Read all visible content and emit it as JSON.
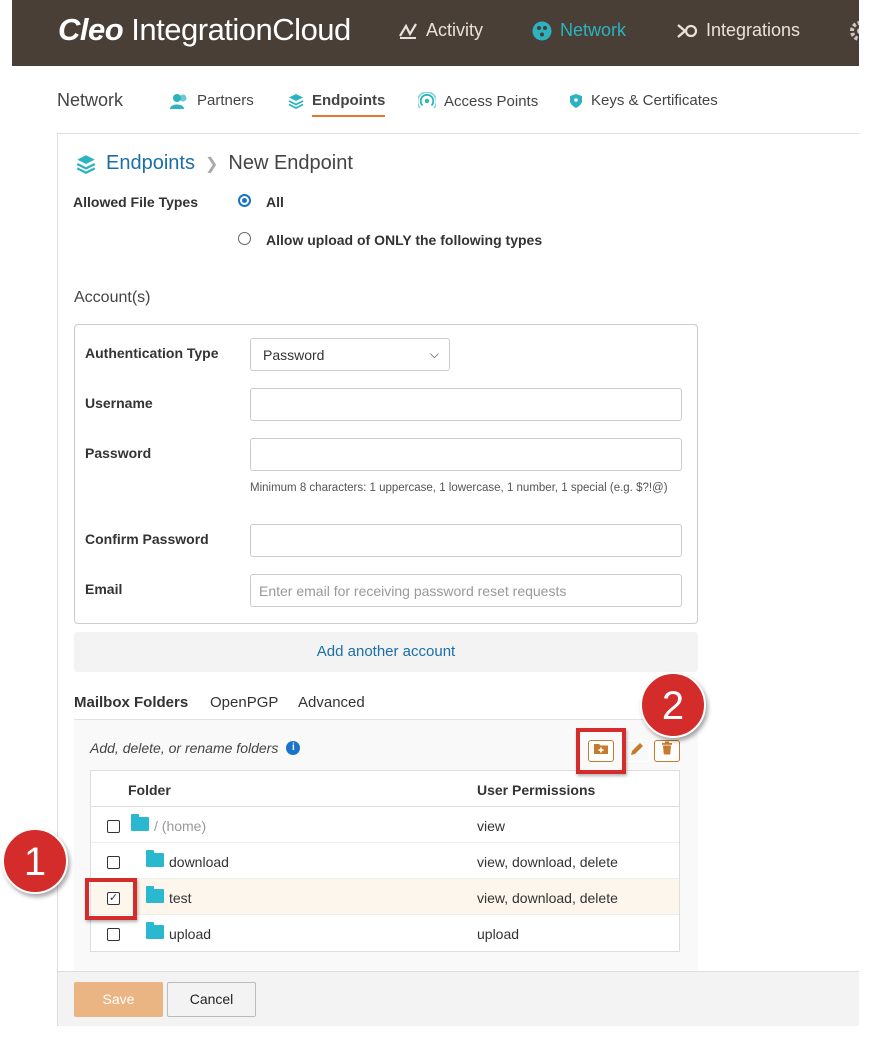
{
  "app": {
    "logo_bold": "Cleo",
    "logo_rest": " IntegrationCloud"
  },
  "topnav": [
    {
      "label": "Activity",
      "icon": "activity-icon"
    },
    {
      "label": "Network",
      "icon": "network-icon",
      "active": true
    },
    {
      "label": "Integrations",
      "icon": "integrations-icon"
    }
  ],
  "subnav": {
    "title": "Network",
    "tabs": [
      {
        "label": "Partners",
        "icon": "partners-icon"
      },
      {
        "label": "Endpoints",
        "icon": "endpoints-icon",
        "active": true
      },
      {
        "label": "Access Points",
        "icon": "access-points-icon"
      },
      {
        "label": "Keys & Certificates",
        "icon": "shield-icon"
      }
    ]
  },
  "breadcrumb": {
    "parent": "Endpoints",
    "current": "New Endpoint"
  },
  "file_types": {
    "label": "Allowed File Types",
    "options": [
      {
        "label": "All",
        "checked": true
      },
      {
        "label": "Allow upload of ONLY the following types",
        "checked": false
      }
    ]
  },
  "account": {
    "heading": "Account(s)",
    "auth_type_label": "Authentication Type",
    "auth_type_value": "Password",
    "username_label": "Username",
    "username_value": "",
    "password_label": "Password",
    "password_value": "",
    "password_hint": "Minimum 8 characters: 1 uppercase, 1 lowercase, 1 number, 1 special (e.g. $?!@)",
    "confirm_label": "Confirm Password",
    "confirm_value": "",
    "email_label": "Email",
    "email_placeholder": "Enter email for receiving password reset requests",
    "add_account": "Add another account"
  },
  "tabs": [
    {
      "label": "Mailbox Folders",
      "active": true
    },
    {
      "label": "OpenPGP"
    },
    {
      "label": "Advanced"
    }
  ],
  "folders": {
    "hint": "Add, delete, or rename folders",
    "columns": {
      "folder": "Folder",
      "permissions": "User Permissions"
    },
    "rows": [
      {
        "name": "/ (home)",
        "perm": "view",
        "checked": false
      },
      {
        "name": "download",
        "perm": "view, download, delete",
        "checked": false
      },
      {
        "name": "test",
        "perm": "view, download, delete",
        "checked": true
      },
      {
        "name": "upload",
        "perm": "upload",
        "checked": false
      }
    ],
    "checked_mark": "✓"
  },
  "footer": {
    "save": "Save",
    "cancel": "Cancel"
  },
  "callouts": {
    "one": "1",
    "two": "2"
  },
  "colors": {
    "accent": "#e07a2f",
    "brand_bar": "#4a3f37",
    "active_nav": "#2bb3c0",
    "link": "#1a6fa6",
    "callout": "#d42b2b"
  }
}
